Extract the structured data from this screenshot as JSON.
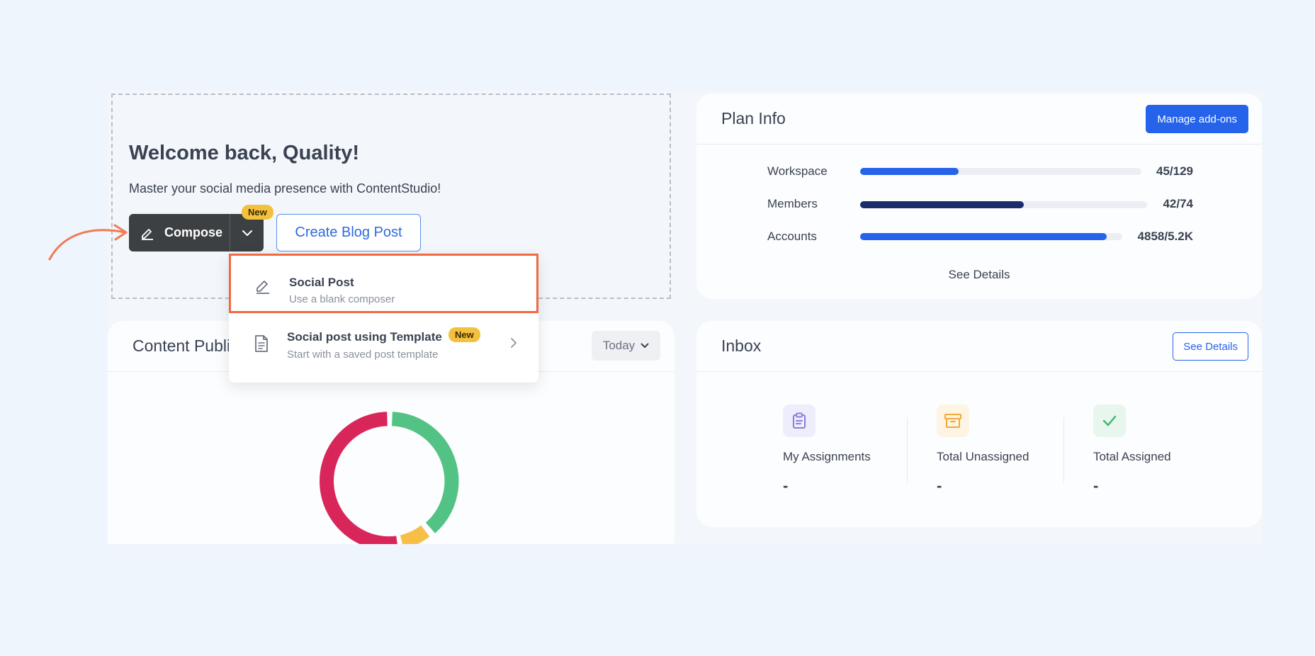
{
  "welcome": {
    "title": "Welcome back, Quality!",
    "subtitle": "Master your social media presence with ContentStudio!",
    "compose_label": "Compose",
    "compose_badge": "New",
    "blog_button": "Create Blog Post"
  },
  "dropdown": {
    "items": [
      {
        "title": "Social Post",
        "description": "Use a blank composer"
      },
      {
        "title": "Social post using Template",
        "description": "Start with a saved post template",
        "badge": "New"
      }
    ]
  },
  "plan": {
    "title": "Plan Info",
    "manage_button": "Manage add-ons",
    "quotas": [
      {
        "label": "Workspace",
        "value": "45/129",
        "fraction": 0.35
      },
      {
        "label": "Members",
        "value": "42/74",
        "fraction": 0.57
      },
      {
        "label": "Accounts",
        "value": "4858/5.2K",
        "fraction": 0.94
      }
    ],
    "see_details": "See Details"
  },
  "content": {
    "title": "Content Publi",
    "filter": "Today"
  },
  "inbox": {
    "title": "Inbox",
    "see_details": "See Details",
    "stats": [
      {
        "label": "My Assignments",
        "value": "-"
      },
      {
        "label": "Total Unassigned",
        "value": "-"
      },
      {
        "label": "Total Assigned",
        "value": "-"
      }
    ]
  },
  "colors": {
    "primary": "#2563eb",
    "dark_bar": "#1b2e6b",
    "highlight": "#f06a42",
    "badge": "#f4c13f",
    "donut_red": "#d9265a",
    "donut_green": "#52c285",
    "donut_yellow": "#f7bf47"
  }
}
